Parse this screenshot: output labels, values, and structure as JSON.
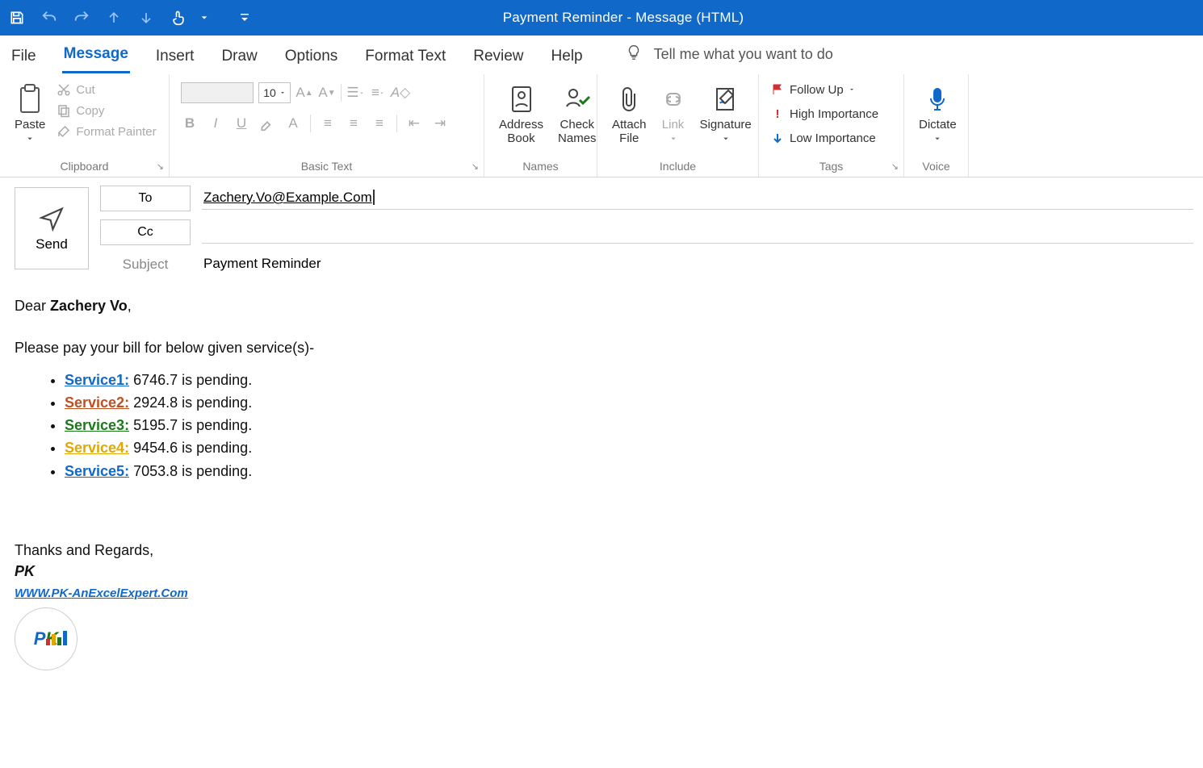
{
  "window_title": "Payment Reminder  -  Message (HTML)",
  "qat": {
    "save": "save",
    "undo": "undo",
    "redo": "redo",
    "prev": "prev",
    "next": "next",
    "touch": "touch"
  },
  "tabs": [
    "File",
    "Message",
    "Insert",
    "Draw",
    "Options",
    "Format Text",
    "Review",
    "Help"
  ],
  "active_tab": 1,
  "tell_me_placeholder": "Tell me what you want to do",
  "ribbon": {
    "clipboard": {
      "label": "Clipboard",
      "paste": "Paste",
      "cut": "Cut",
      "copy": "Copy",
      "format_painter": "Format Painter"
    },
    "basic_text": {
      "label": "Basic Text",
      "font_size": "10"
    },
    "names": {
      "label": "Names",
      "address_book": "Address\nBook",
      "check_names": "Check\nNames"
    },
    "include": {
      "label": "Include",
      "attach_file": "Attach\nFile",
      "link": "Link",
      "signature": "Signature"
    },
    "tags": {
      "label": "Tags",
      "follow_up": "Follow Up",
      "high": "High Importance",
      "low": "Low Importance"
    },
    "voice": {
      "label": "Voice",
      "dictate": "Dictate"
    }
  },
  "compose": {
    "send": "Send",
    "to_label": "To",
    "cc_label": "Cc",
    "subject_label": "Subject",
    "to_value": "Zachery.Vo@Example.Com",
    "subject_value": "Payment Reminder"
  },
  "body": {
    "salutation_prefix": "Dear ",
    "salutation_name": "Zachery Vo",
    "salutation_suffix": ",",
    "intro": "Please pay your bill for below given service(s)-",
    "services": [
      {
        "label": "Service1:",
        "value": "6746.7 is pending.",
        "color": "#1068c9"
      },
      {
        "label": "Service2:",
        "value": "2924.8 is pending.",
        "color": "#c05020"
      },
      {
        "label": "Service3:",
        "value": "5195.7 is pending.",
        "color": "#1a7a1a"
      },
      {
        "label": "Service4:",
        "value": "9454.6 is pending.",
        "color": "#e0a800"
      },
      {
        "label": "Service5:",
        "value": "7053.8 is pending.",
        "color": "#1068c9"
      }
    ],
    "regards": "Thanks and Regards,",
    "sign_name": "PK",
    "sign_url": "WWW.PK-AnExcelExpert.Com"
  }
}
